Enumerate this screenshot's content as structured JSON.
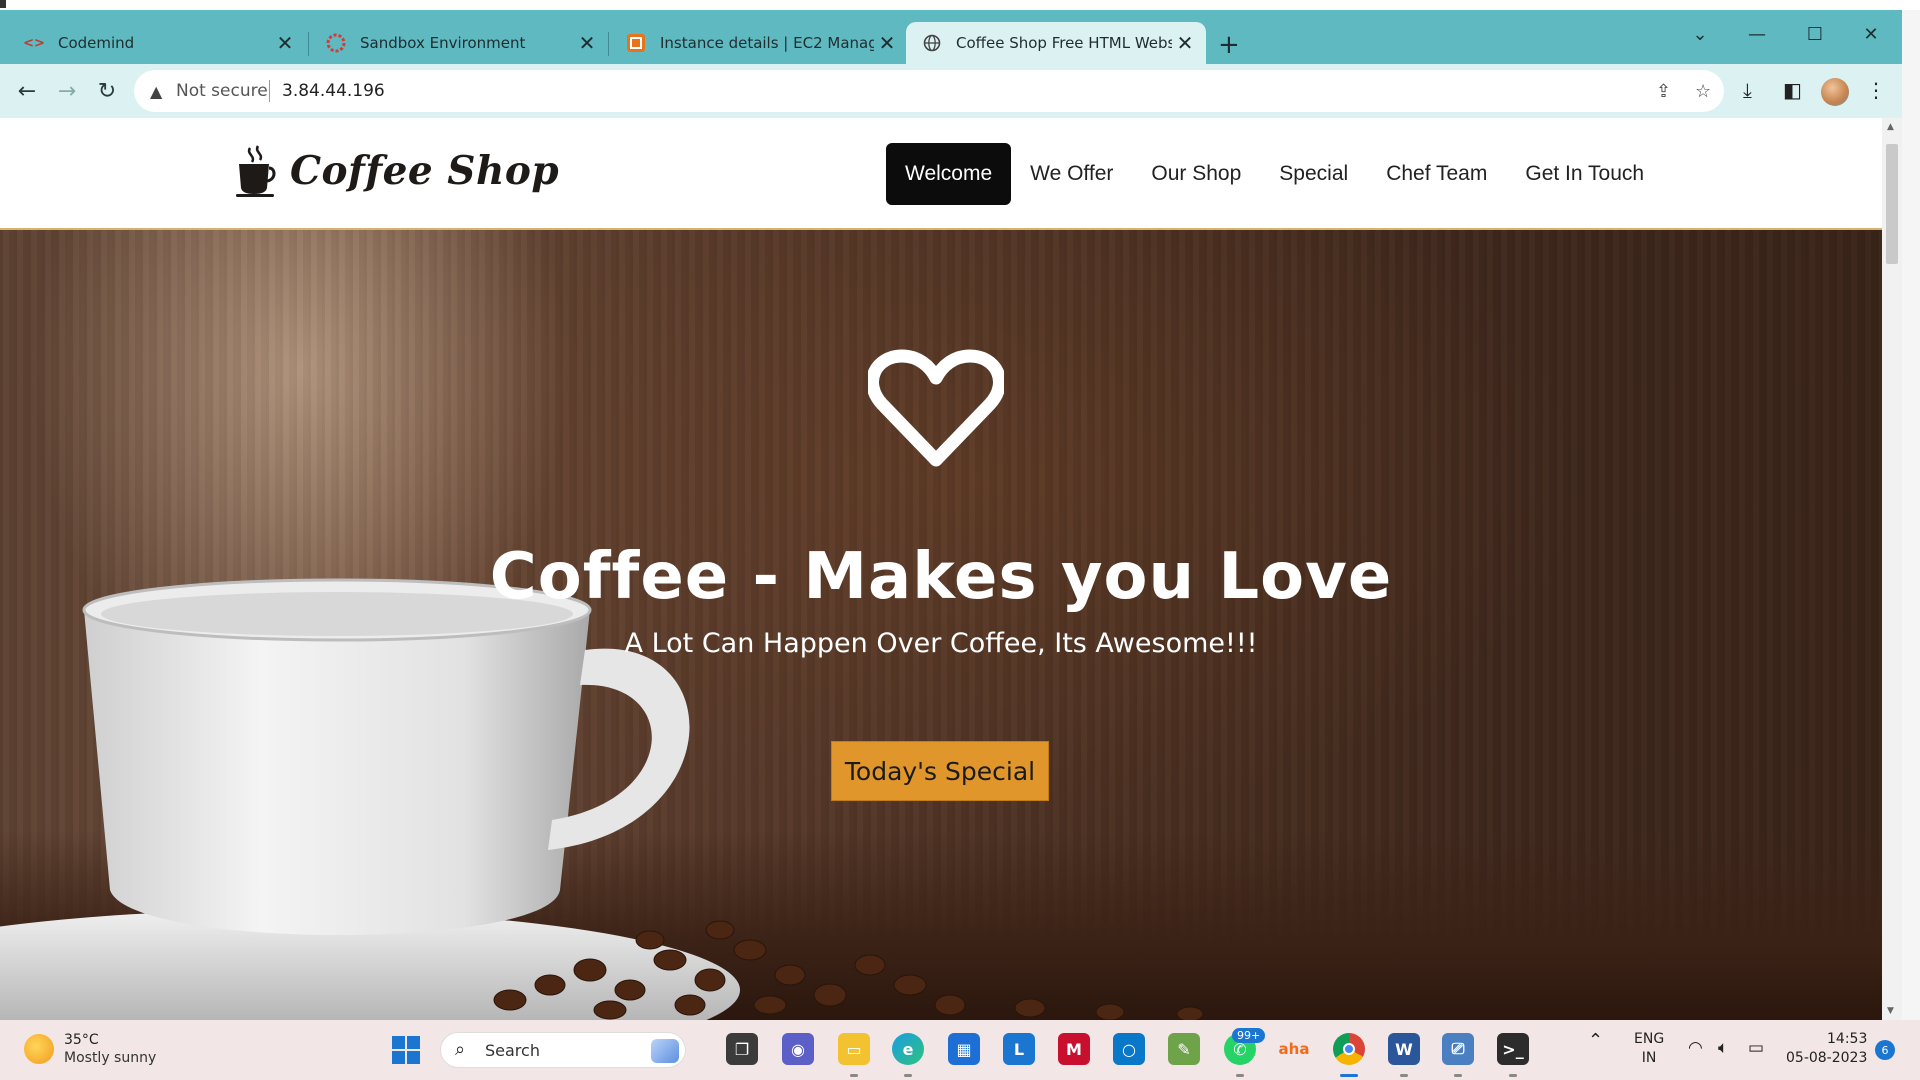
{
  "browser": {
    "tabs": [
      {
        "title": "Codemind",
        "icon": "codemind-icon"
      },
      {
        "title": "Sandbox Environment",
        "icon": "sandbox-icon"
      },
      {
        "title": "Instance details | EC2 Manageme",
        "icon": "aws-icon"
      },
      {
        "title": "Coffee Shop Free HTML Website",
        "icon": "globe-icon",
        "active": true
      }
    ],
    "new_tab_label": "+",
    "security_label": "Not secure",
    "url": "3.84.44.196"
  },
  "site": {
    "brand": "Coffee Shop",
    "nav": [
      {
        "label": "Welcome",
        "active": true
      },
      {
        "label": "We Offer"
      },
      {
        "label": "Our Shop"
      },
      {
        "label": "Special"
      },
      {
        "label": "Chef Team"
      },
      {
        "label": "Get In Touch"
      }
    ],
    "hero": {
      "title": "Coffee - Makes you Love",
      "subtitle": "A Lot Can Happen Over Coffee, Its Awesome!!!",
      "button": "Today's Special"
    },
    "colors": {
      "accent_button": "#e1962c",
      "nav_active_bg": "#0c0c0c",
      "header_border": "#d9b16f"
    }
  },
  "taskbar": {
    "weather_temp": "35°C",
    "weather_condition": "Mostly sunny",
    "search_label": "Search",
    "whatsapp_badge": "99+",
    "language": "ENG",
    "region": "IN",
    "time": "14:53",
    "date": "05-08-2023",
    "notification_count": "6"
  },
  "colors": {
    "tab_strip": "#5fb9c1",
    "toolbar": "#dcf1f2",
    "taskbar": "#f3e6e6"
  }
}
